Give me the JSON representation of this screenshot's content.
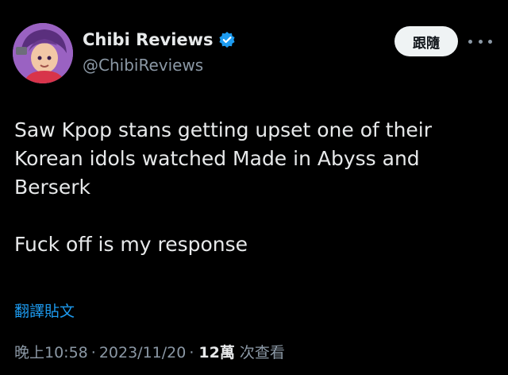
{
  "author": {
    "display_name": "Chibi Reviews",
    "handle": "@ChibiReviews",
    "verified_icon": "verified-badge-icon",
    "avatar_icon": "avatar-image"
  },
  "follow_button_label": "跟隨",
  "more_icon": "more-options-icon",
  "tweet": {
    "paragraph_1": "Saw Kpop stans getting upset one of their Korean idols watched Made in Abyss and Berserk",
    "paragraph_2": "Fuck off is my response"
  },
  "translate_label": "翻譯貼文",
  "meta": {
    "time": "晚上10:58",
    "separator": "·",
    "date": "2023/11/20",
    "views_count": "12萬",
    "views_label": "次查看"
  },
  "colors": {
    "background": "#000000",
    "text_primary": "#e7e9ea",
    "text_secondary": "#8b98a5",
    "link": "#1d9bf0",
    "verified": "#1d9bf0",
    "button_bg": "#eff3f4"
  }
}
